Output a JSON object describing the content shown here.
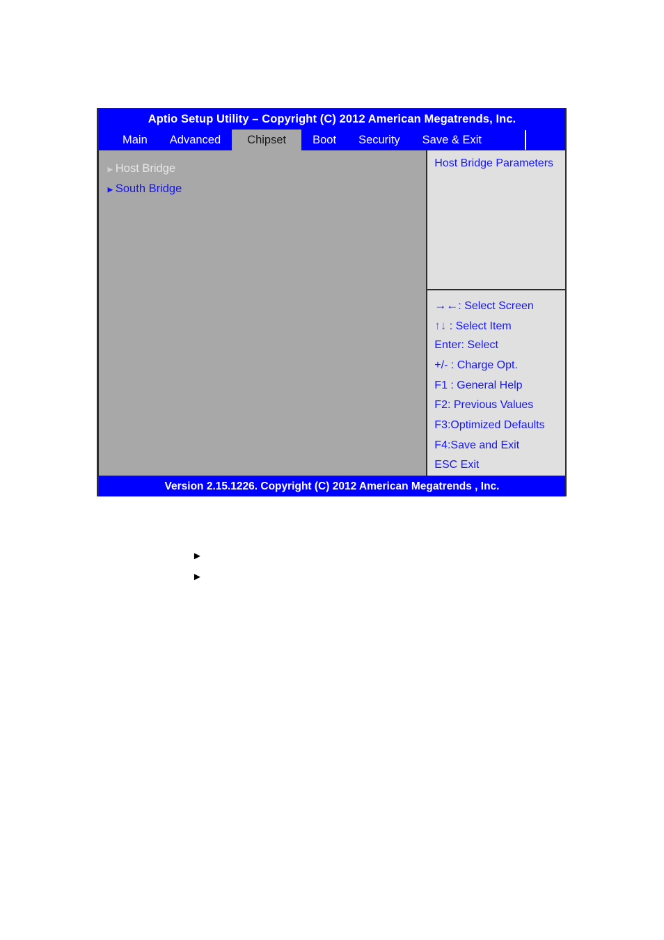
{
  "bios": {
    "title": "Aptio Setup Utility – Copyright (C) 2012 American Megatrends, Inc.",
    "tabs": [
      {
        "label": "Main",
        "selected": false
      },
      {
        "label": "Advanced",
        "selected": false
      },
      {
        "label": "Chipset",
        "selected": true
      },
      {
        "label": "Boot",
        "selected": false
      },
      {
        "label": "Security",
        "selected": false
      },
      {
        "label": "Save & Exit",
        "selected": false
      }
    ],
    "settings": [
      {
        "label": "Host Bridge",
        "marker": "►",
        "selected": true
      },
      {
        "label": "South Bridge",
        "marker": "►",
        "selected": false
      }
    ],
    "help": {
      "text": "Host Bridge Parameters"
    },
    "legend": [
      {
        "keys": "→←",
        "text": ": Select Screen"
      },
      {
        "keys": "↑↓",
        "text": "  : Select Item"
      },
      {
        "keys": "Enter:",
        "text": "   Select"
      },
      {
        "keys": "+/-",
        "text": " : Charge Opt."
      },
      {
        "keys": "F1",
        "text": " : General Help"
      },
      {
        "keys": "F2:",
        "text": " Previous Values"
      },
      {
        "keys": "F3:",
        "text": "Optimized Defaults"
      },
      {
        "keys": "F4:",
        "text": "Save and Exit"
      },
      {
        "keys": "ESC",
        "text": "   Exit"
      }
    ],
    "version": "Version 2.15.1226. Copyright (C) 2012 American Megatrends , Inc.",
    "colors": {
      "title_bar": "#0000ff",
      "settings_panel": "#a8a8a8",
      "help_panel": "#e0e0e0",
      "accent_text": "#1414ff"
    }
  },
  "captions": [
    {
      "marker": "►",
      "text": ""
    },
    {
      "marker": "►",
      "text": ""
    }
  ]
}
